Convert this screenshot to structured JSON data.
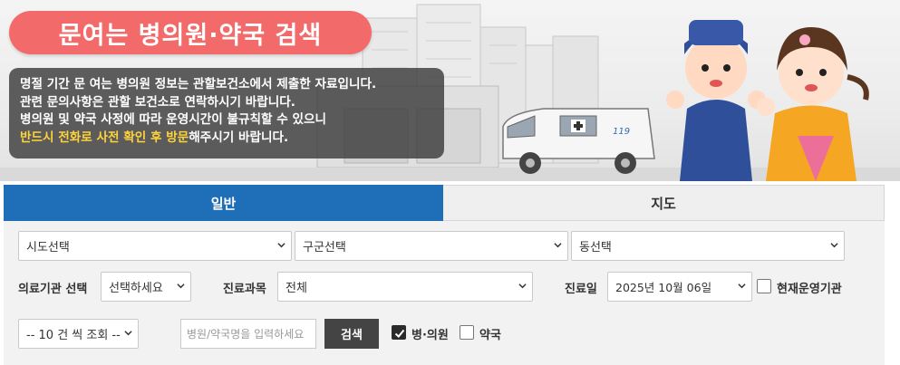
{
  "banner": {
    "title": "문여는 병의원·약국 검색",
    "notice": {
      "line1": "명절 기간 문 여는 병의원 정보는 관할보건소에서 제출한 자료입니다.",
      "line2": "관련 문의사항은 관할 보건소로 연락하시기 바랍니다.",
      "line3": "병의원 및 약국 사정에 따라 운영시간이 불규칙할 수 있으니",
      "line4_highlight": "반드시 전화로 사전 확인 후 방문",
      "line4_rest": "해주시기 바랍니다."
    },
    "colors": {
      "title_bg": "#f26a6a",
      "highlight": "#ffd43b"
    }
  },
  "tabs": [
    {
      "label": "일반",
      "active": true
    },
    {
      "label": "지도",
      "active": false
    }
  ],
  "filters": {
    "sido": {
      "value": "시도선택"
    },
    "gugun": {
      "value": "구군선택"
    },
    "dong": {
      "value": "동선택"
    },
    "institution": {
      "label": "의료기관 선택",
      "value": "선택하세요"
    },
    "department": {
      "label": "진료과목",
      "value": "전체"
    },
    "date": {
      "label": "진료일",
      "value": "2025년 10월 06일"
    },
    "open_now": {
      "label": "현재운영기관",
      "checked": false
    },
    "page_size": {
      "value": "-- 10 건 씩 조회 --"
    },
    "search": {
      "placeholder": "병원/약국명을 입력하세요",
      "button_label": "검색"
    },
    "hospital": {
      "label": "병·의원",
      "checked": true
    },
    "pharmacy": {
      "label": "약국",
      "checked": false
    }
  },
  "icons": {
    "chevron": "chevron-down-icon",
    "check": "check-icon"
  },
  "accent_color": "#1f6fb8"
}
